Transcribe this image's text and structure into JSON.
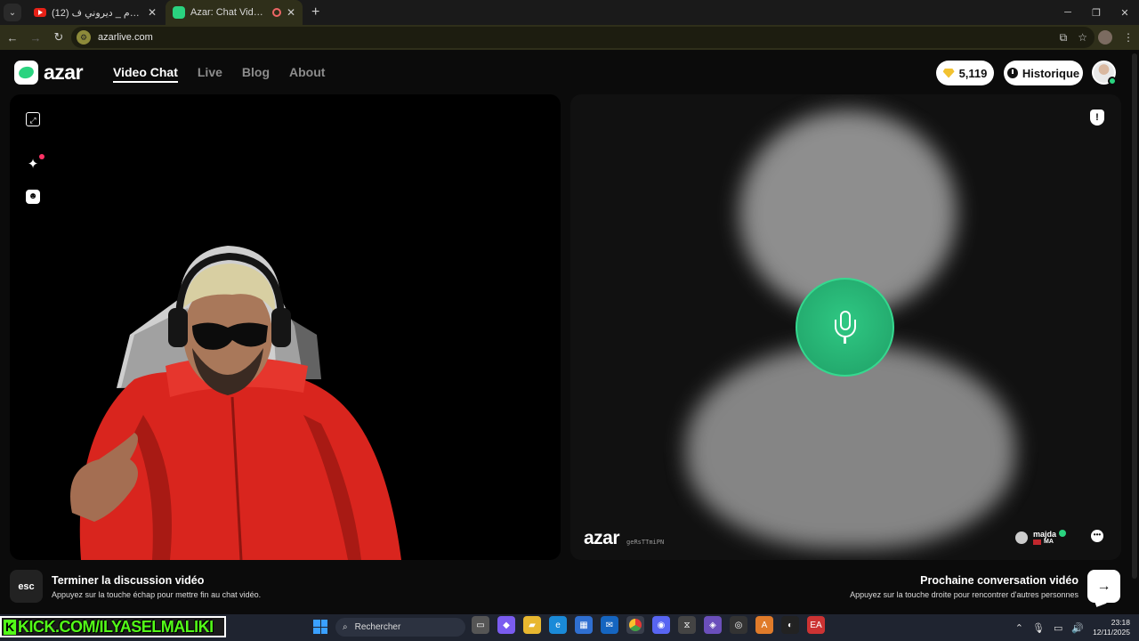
{
  "browser": {
    "tabs": [
      {
        "title": "(12) مجموعة السهام _ ديروني ف...",
        "active": false
      },
      {
        "title": "Azar: Chat Vidéo, Rencontre...",
        "active": true
      }
    ],
    "url": "azarlive.com"
  },
  "header": {
    "logo_text": "azar",
    "nav": [
      {
        "label": "Video Chat",
        "active": true
      },
      {
        "label": "Live",
        "active": false
      },
      {
        "label": "Blog",
        "active": false
      },
      {
        "label": "About",
        "active": false
      }
    ],
    "gems": "5,119",
    "history_label": "Historique"
  },
  "partner": {
    "watermark": "azar",
    "code": "geRsTTmiPN",
    "name": "majda",
    "country": "MA"
  },
  "hints": {
    "esc_key": "esc",
    "end_title": "Terminer la discussion vidéo",
    "end_sub": "Appuyez sur la touche échap pour mettre fin au chat vidéo.",
    "next_title": "Prochaine conversation vidéo",
    "next_sub": "Appuyez sur la touche droite pour rencontrer d'autres personnes"
  },
  "taskbar": {
    "kick_text": "KICK.COM/ILYASELMALIKI",
    "search_placeholder": "Rechercher",
    "time": "23:18",
    "date": "12/11/2025"
  },
  "colors": {
    "accent_green": "#2ad37f",
    "mic_green": "#22a96c",
    "kick_green": "#53fc18"
  }
}
